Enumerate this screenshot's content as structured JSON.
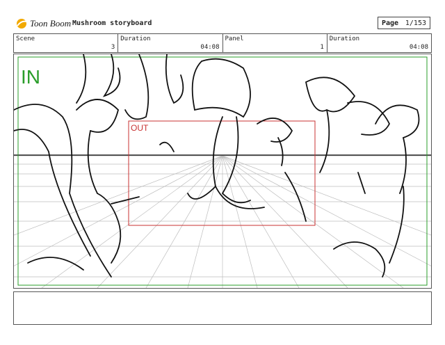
{
  "header": {
    "brand": "Toon Boom",
    "title": "Mushroom storyboard",
    "page_label": "Page",
    "page_value": "1/153"
  },
  "meta": [
    {
      "key": "Scene",
      "value": "3"
    },
    {
      "key": "Duration",
      "value": "04:08"
    },
    {
      "key": "Panel",
      "value": "1"
    },
    {
      "key": "Duration",
      "value": "04:08"
    }
  ],
  "panel": {
    "in_label": "IN",
    "out_label": "OUT",
    "in_color": "#2a9d2a",
    "out_color": "#c83232"
  },
  "notes": {
    "text": ""
  }
}
